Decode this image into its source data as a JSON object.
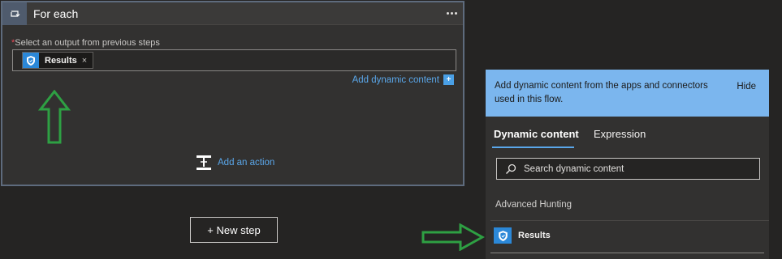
{
  "foreach_card": {
    "title": "For each",
    "required_mark": "*",
    "field_label": "Select an output from previous steps",
    "token": {
      "label": "Results",
      "close": "×",
      "icon": "shield-icon"
    },
    "add_dynamic_label": "Add dynamic content",
    "add_dynamic_icon": "+",
    "add_action_label": "Add an action"
  },
  "new_step_label": "+ New step",
  "dynamic_panel": {
    "banner_text": "Add dynamic content from the apps and connectors used in this flow.",
    "hide_label": "Hide",
    "tabs": [
      {
        "label": "Dynamic content",
        "active": true
      },
      {
        "label": "Expression",
        "active": false
      }
    ],
    "search_placeholder": "Search dynamic content",
    "section_title": "Advanced Hunting",
    "items": [
      {
        "label": "Results",
        "icon": "shield-icon"
      }
    ]
  },
  "colors": {
    "accent": "#5aa7ea",
    "banner": "#7bb6ee",
    "annotation_arrow": "#2ea043",
    "connector_icon": "#2b88d8"
  }
}
